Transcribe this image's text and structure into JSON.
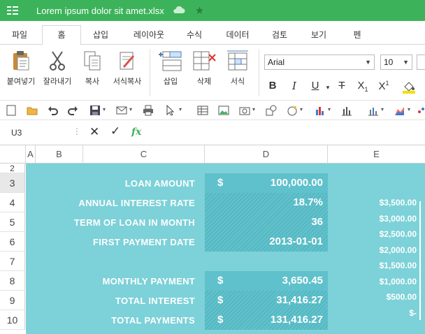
{
  "titlebar": {
    "filename": "Lorem ipsum dolor sit amet.xlsx",
    "bg": "#3cb35a"
  },
  "tabs": [
    {
      "label": "파일",
      "active": false
    },
    {
      "label": "홈",
      "active": true
    },
    {
      "label": "삽입",
      "active": false
    },
    {
      "label": "레이아웃",
      "active": false
    },
    {
      "label": "수식",
      "active": false
    },
    {
      "label": "데이터",
      "active": false
    },
    {
      "label": "검토",
      "active": false
    },
    {
      "label": "보기",
      "active": false
    },
    {
      "label": "펜",
      "active": false
    }
  ],
  "ribbon": {
    "paste": "붙여넣기",
    "cut": "잘라내기",
    "copy": "복사",
    "format_copy": "서식복사",
    "insert": "삽입",
    "delete": "삭제",
    "format": "서식",
    "font_name": "Arial",
    "font_size": "10"
  },
  "formula_bar": {
    "name_box": "U3",
    "fx": "fx",
    "content": ""
  },
  "columns": [
    "A",
    "B",
    "C",
    "D",
    "E"
  ],
  "rows": [
    "2",
    "3",
    "4",
    "5",
    "6",
    "7",
    "8",
    "9",
    "10"
  ],
  "selected_row": "3",
  "loan": {
    "amount_label": "LOAN AMOUNT",
    "amount_currency": "$",
    "amount_value": "100,000.00",
    "rate_label": "ANNUAL INTEREST RATE",
    "rate_value": "18.7%",
    "term_label": "TERM OF LOAN IN MONTH",
    "term_value": "36",
    "first_label": "FIRST PAYMENT DATE",
    "first_value": "2013-01-01",
    "monthly_label": "MONTHLY PAYMENT",
    "monthly_currency": "$",
    "monthly_value": "3,650.45",
    "interest_label": "TOTAL INTEREST",
    "interest_currency": "$",
    "interest_value": "31,416.27",
    "payments_label": "TOTAL PAYMENTS",
    "payments_currency": "$",
    "payments_value": "131,416.27"
  },
  "chart_axis": {
    "ticks": [
      "$3,500.00",
      "$3,000.00",
      "$2,500.00",
      "$2,000.00",
      "$1,500.00",
      "$1,000.00",
      "$500.00",
      "$-"
    ]
  },
  "colors": {
    "accent": "#3cb35a",
    "sheet_bg": "#7dd1d8",
    "band": "#5fc1cb"
  }
}
